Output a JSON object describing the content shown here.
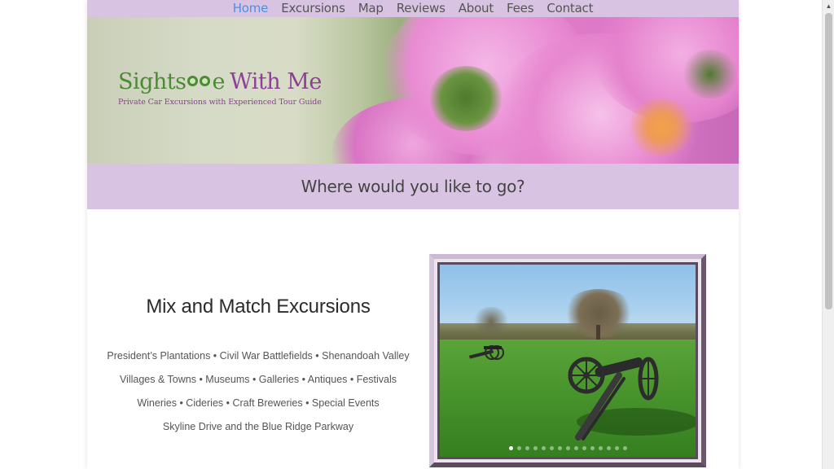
{
  "nav": {
    "items": [
      {
        "label": "Home",
        "active": true
      },
      {
        "label": "Excursions",
        "active": false
      },
      {
        "label": "Map",
        "active": false
      },
      {
        "label": "Reviews",
        "active": false
      },
      {
        "label": "About",
        "active": false
      },
      {
        "label": "Fees",
        "active": false
      },
      {
        "label": "Contact",
        "active": false
      }
    ]
  },
  "logo": {
    "word1": "Sights",
    "word1_end": "e",
    "word2": "With Me",
    "tagline": "Private Car Excursions with Experienced Tour Guide"
  },
  "question": "Where would you like to go?",
  "mix": {
    "title": "Mix and Match Excursions",
    "lines": [
      "President’s Plantations • Civil War Battlefields • Shenandoah Valley",
      "Villages & Towns • Museums • Galleries • Antiques • Festivals",
      "Wineries • Cideries • Craft Breweries • Special Events",
      "Skyline Drive and the Blue Ridge Parkway"
    ]
  },
  "slider": {
    "slide_count": 15,
    "active_index": 0
  },
  "colors": {
    "accent_lavender": "#d9c3e3",
    "nav_active": "#4c8fe0",
    "logo_green": "#4c8a35",
    "logo_purple": "#8e3f98"
  },
  "icons": {
    "scroll_up": "▲"
  }
}
